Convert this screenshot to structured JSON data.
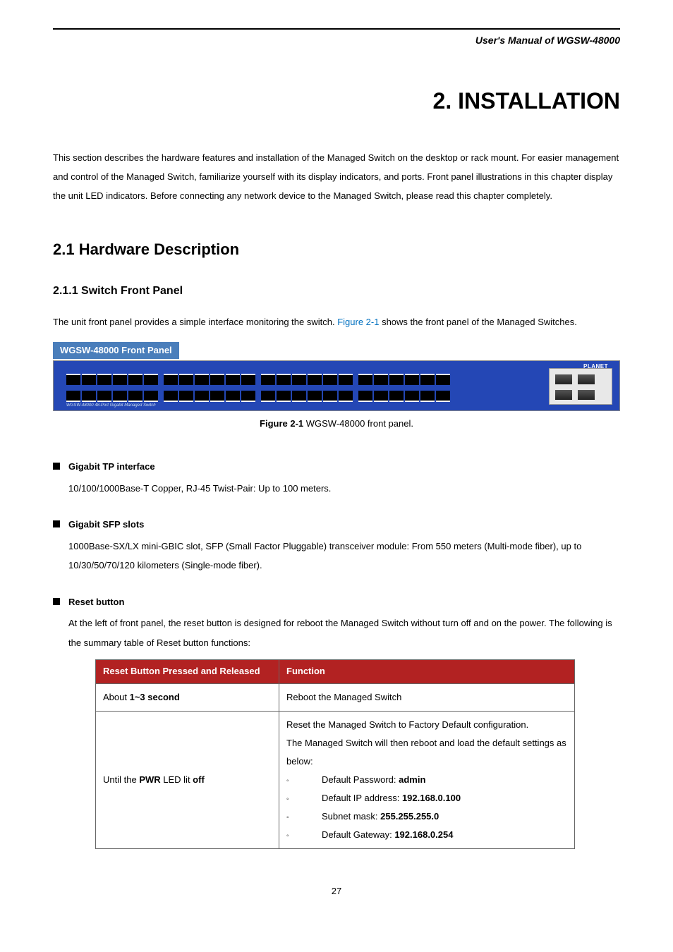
{
  "header": {
    "manual_title": "User's Manual of WGSW-48000"
  },
  "chapter": {
    "title": "2. INSTALLATION",
    "intro": "This section describes the hardware features and installation of the Managed Switch on the desktop or rack mount. For easier management and control of the Managed Switch, familiarize yourself with its display indicators, and ports. Front panel illustrations in this chapter display the unit LED indicators. Before connecting any network device to the Managed Switch, please read this chapter completely."
  },
  "section_2_1": {
    "title": "2.1 Hardware Description",
    "subsection_title": "2.1.1 Switch Front Panel",
    "para_pre": "The unit front panel provides a simple interface monitoring the switch. ",
    "figure_ref": "Figure 2-1",
    "para_post": " shows the front panel of the Managed Switches.",
    "panel_label": "WGSW-48000 Front Panel",
    "switch_model_text": "WGSW-48000    48-Port Gigabit Managed Switch",
    "logo_text": "PLANET",
    "caption_bold": "Figure 2-1",
    "caption_rest": " WGSW-48000 front panel."
  },
  "interfaces": {
    "tp": {
      "title": "Gigabit TP interface",
      "body": "10/100/1000Base-T Copper, RJ-45 Twist-Pair: Up to 100 meters."
    },
    "sfp": {
      "title": "Gigabit SFP slots",
      "body": "1000Base-SX/LX mini-GBIC slot, SFP (Small Factor Pluggable) transceiver module: From 550 meters (Multi-mode fiber), up to 10/30/50/70/120 kilometers (Single-mode fiber)."
    },
    "reset": {
      "title": "Reset button",
      "body": "At the left of front panel, the reset button is designed for reboot the Managed Switch without turn off and on the power. The following is the summary table of Reset button functions:"
    }
  },
  "reset_table": {
    "header_col1": "Reset Button Pressed and Released",
    "header_col2": "Function",
    "row1_col1_pre": "About ",
    "row1_col1_bold": "1~3 second",
    "row1_col2": "Reboot the Managed Switch",
    "row2_col1_pre": "Until the ",
    "row2_col1_bold1": "PWR",
    "row2_col1_mid": " LED lit ",
    "row2_col1_bold2": "off",
    "row2_line1": "Reset the Managed Switch to Factory Default configuration.",
    "row2_line2": "The Managed Switch will then reboot and load the default settings as below:",
    "row2_items": [
      {
        "label": "Default Password: ",
        "value": "admin"
      },
      {
        "label": "Default IP address: ",
        "value": "192.168.0.100"
      },
      {
        "label": "Subnet mask: ",
        "value": "255.255.255.0"
      },
      {
        "label": "Default Gateway: ",
        "value": "192.168.0.254"
      }
    ]
  },
  "page_number": "27"
}
